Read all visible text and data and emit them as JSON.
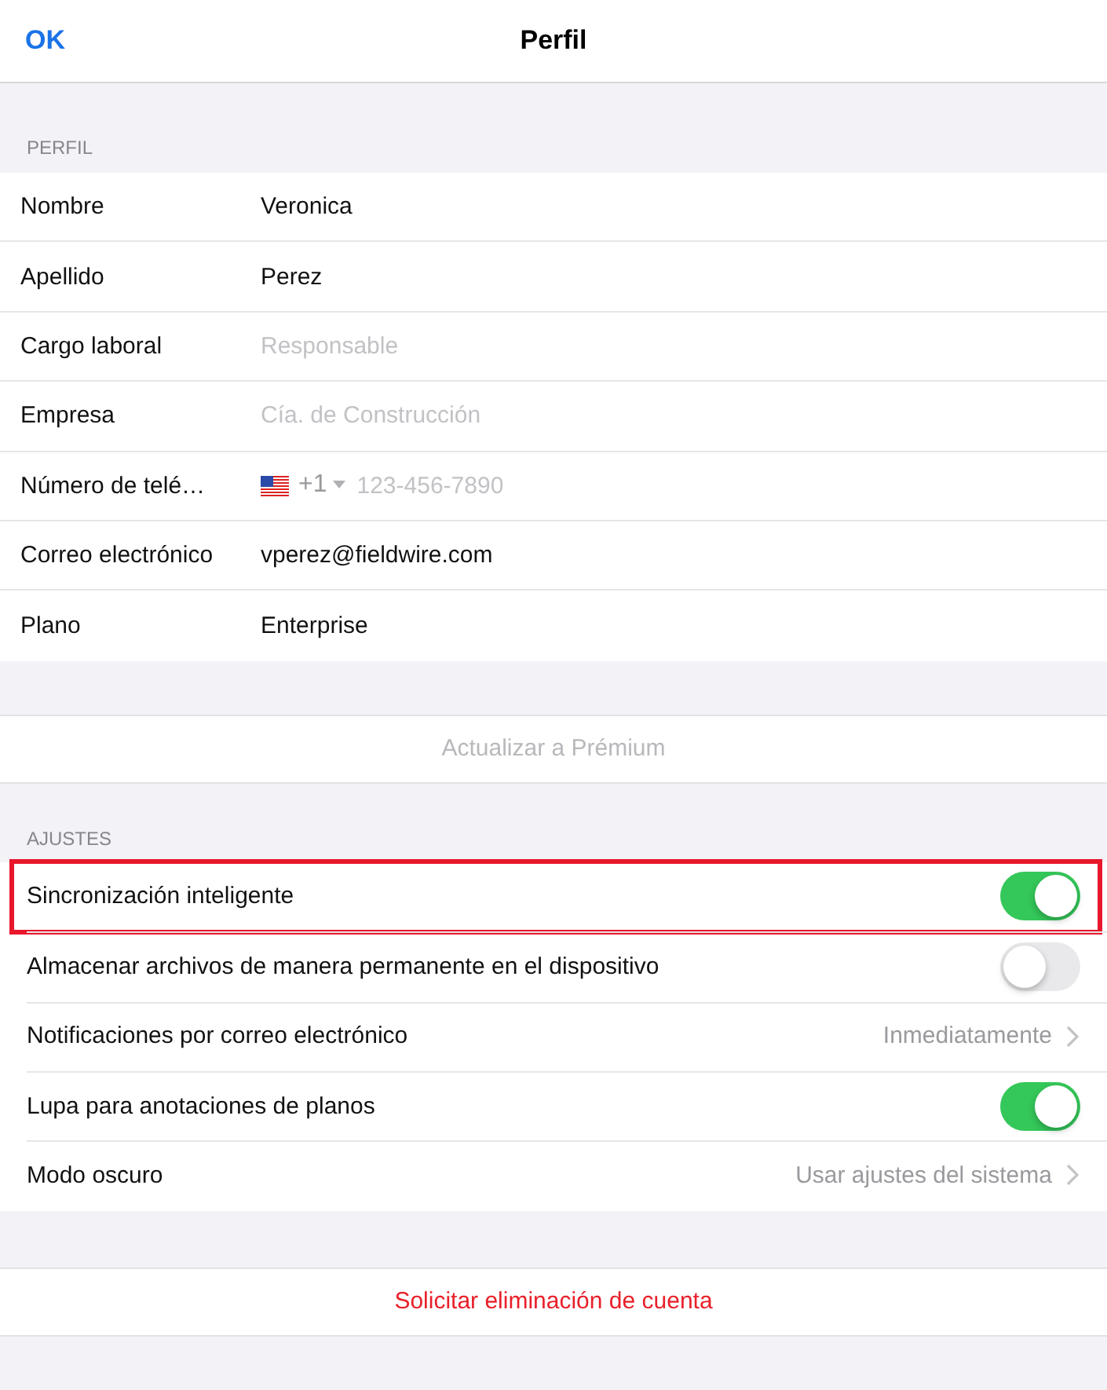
{
  "nav": {
    "done_button": "OK",
    "title": "Perfil"
  },
  "profile": {
    "header": "PERFIL",
    "rows": [
      {
        "kind": "text",
        "label": "Nombre",
        "value": "Veronica"
      },
      {
        "kind": "text",
        "label": "Apellido",
        "value": "Perez"
      },
      {
        "kind": "text",
        "label": "Cargo laboral",
        "placeholder": "Responsable"
      },
      {
        "kind": "text",
        "label": "Empresa",
        "placeholder": "Cía. de Construcción"
      },
      {
        "kind": "phone",
        "label": "Número de telé…",
        "country_code": "+1",
        "placeholder": "123-456-7890"
      },
      {
        "kind": "text",
        "label": "Correo electrónico",
        "value": "vperez@fieldwire.com"
      },
      {
        "kind": "text",
        "label": "Plano",
        "value": "Enterprise"
      }
    ]
  },
  "upgrade_button": {
    "label": "Actualizar a Prémium",
    "disabled": true
  },
  "settings": {
    "header": "AJUSTES",
    "rows": [
      {
        "kind": "toggle",
        "label": "Sincronización inteligente",
        "on": true,
        "highlighted": true
      },
      {
        "kind": "toggle",
        "label": "Almacenar archivos de manera permanente en el dispositivo",
        "on": false,
        "highlighted": false
      },
      {
        "kind": "link",
        "label": "Notificaciones por correo electrónico",
        "value": "Inmediatamente",
        "highlighted": false
      },
      {
        "kind": "toggle",
        "label": "Lupa para anotaciones de planos",
        "on": true,
        "highlighted": false
      },
      {
        "kind": "link",
        "label": "Modo oscuro",
        "value": "Usar ajustes del sistema",
        "highlighted": false
      }
    ]
  },
  "delete_button": "Solicitar eliminación de cuenta"
}
